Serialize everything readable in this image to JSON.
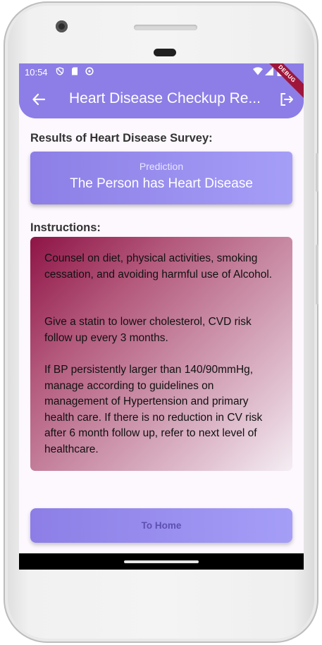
{
  "status_bar": {
    "time": "10:54",
    "icons": [
      "privacy-shield-icon",
      "sd-card-icon",
      "face-icon",
      "wifi-icon",
      "signal-icon",
      "battery-icon"
    ]
  },
  "app_bar": {
    "title": "Heart Disease Checkup Re...",
    "back_icon": "arrow-back-icon",
    "logout_icon": "logout-icon",
    "debug_banner": "DEBUG"
  },
  "results": {
    "heading": "Results of Heart Disease Survey:",
    "prediction_label": "Prediction",
    "prediction_value": "The Person has Heart Disease"
  },
  "instructions": {
    "heading": "Instructions:",
    "paragraphs": [
      "Counsel on diet, physical activities, smoking cessation, and avoiding harmful use of Alcohol.",
      "Give a statin to lower cholesterol, CVD risk follow up every 3 months.",
      "If BP persistently larger than 140/90mmHg, manage according to guidelines on management of Hypertension and primary health care. If there is no reduction in CV risk after 6 month follow up, refer to next level of healthcare."
    ]
  },
  "actions": {
    "home_label": "To Home"
  },
  "colors": {
    "primary": "#8c7ee6",
    "primary_light": "#a59ef7",
    "instructions_gradient_start": "#8e1446",
    "instructions_gradient_end": "#f4eef3",
    "background": "#fdf7fe"
  }
}
